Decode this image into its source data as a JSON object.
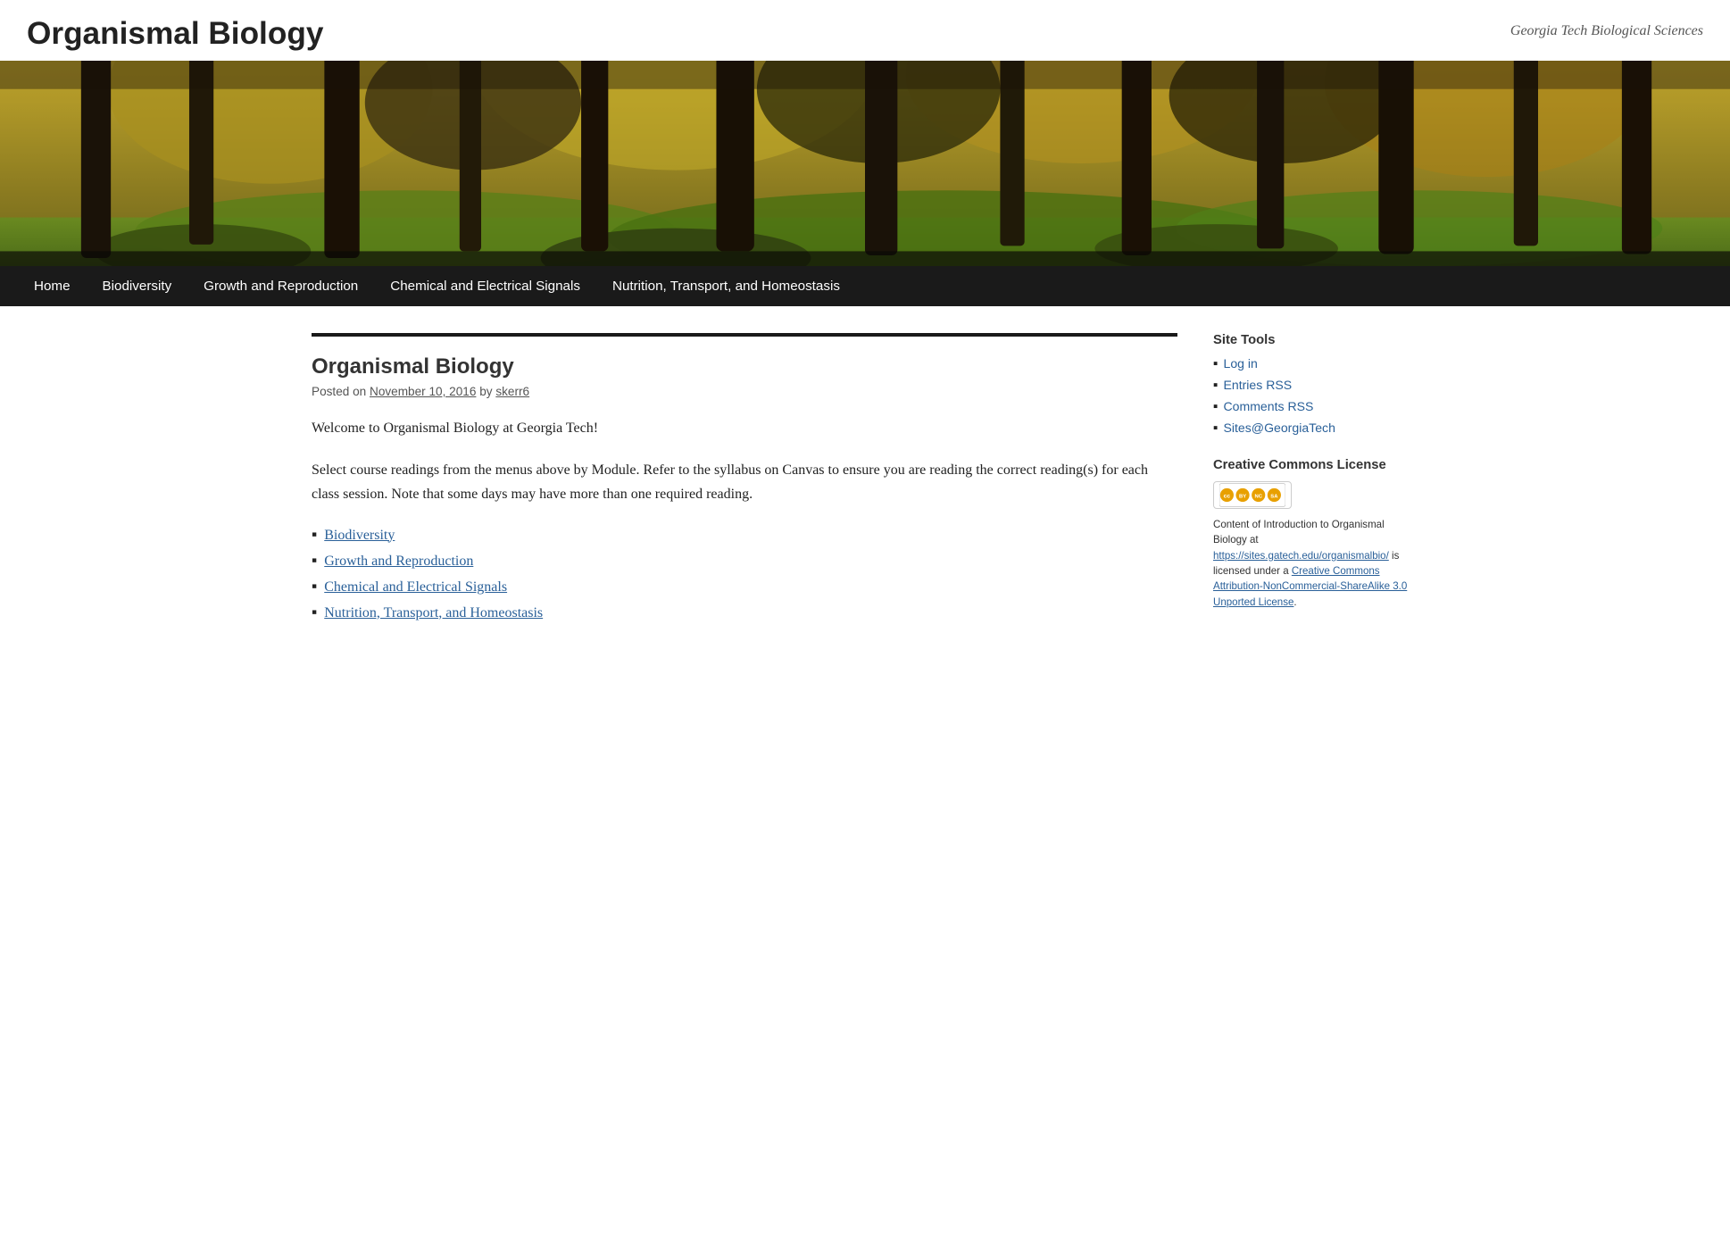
{
  "header": {
    "site_title": "Organismal Biology",
    "site_subtitle": "Georgia Tech Biological Sciences"
  },
  "nav": {
    "items": [
      {
        "label": "Home",
        "href": "#"
      },
      {
        "label": "Biodiversity",
        "href": "#"
      },
      {
        "label": "Growth and Reproduction",
        "href": "#"
      },
      {
        "label": "Chemical and Electrical Signals",
        "href": "#"
      },
      {
        "label": "Nutrition, Transport, and Homeostasis",
        "href": "#"
      }
    ]
  },
  "post": {
    "title": "Organismal Biology",
    "meta": {
      "prefix": "Posted on",
      "date": "November 10, 2016",
      "by": "by",
      "author": "skerr6"
    },
    "intro1": "Welcome to Organismal Biology at Georgia Tech!",
    "intro2": "Select course readings from the menus above by Module. Refer to the syllabus on Canvas to ensure you are reading the correct reading(s) for each class session. Note that some days may have more than one required reading.",
    "links": [
      {
        "label": "Biodiversity",
        "href": "#"
      },
      {
        "label": "Growth and Reproduction",
        "href": "#"
      },
      {
        "label": "Chemical and Electrical Signals",
        "href": "#"
      },
      {
        "label": "Nutrition, Transport, and Homeostasis",
        "href": "#"
      }
    ]
  },
  "sidebar": {
    "tools_title": "Site Tools",
    "tools": [
      {
        "label": "Log in",
        "href": "#"
      },
      {
        "label": "Entries RSS",
        "href": "#"
      },
      {
        "label": "Comments RSS",
        "href": "#"
      },
      {
        "label": "Sites@GeorgiaTech",
        "href": "#"
      }
    ],
    "cc_title": "Creative Commons License",
    "cc_icons": [
      "CC",
      "BY",
      "NC",
      "SA"
    ],
    "cc_text_before": "Content of Introduction to Organismal Biology at",
    "cc_url": "https://sites.gatech.edu/organismalbio/",
    "cc_text_middle": "is licensed under a",
    "cc_license_label": "Creative Commons Attribution-NonCommercial-ShareAlike 3.0 Unported License",
    "cc_license_href": "#",
    "cc_period": "."
  }
}
